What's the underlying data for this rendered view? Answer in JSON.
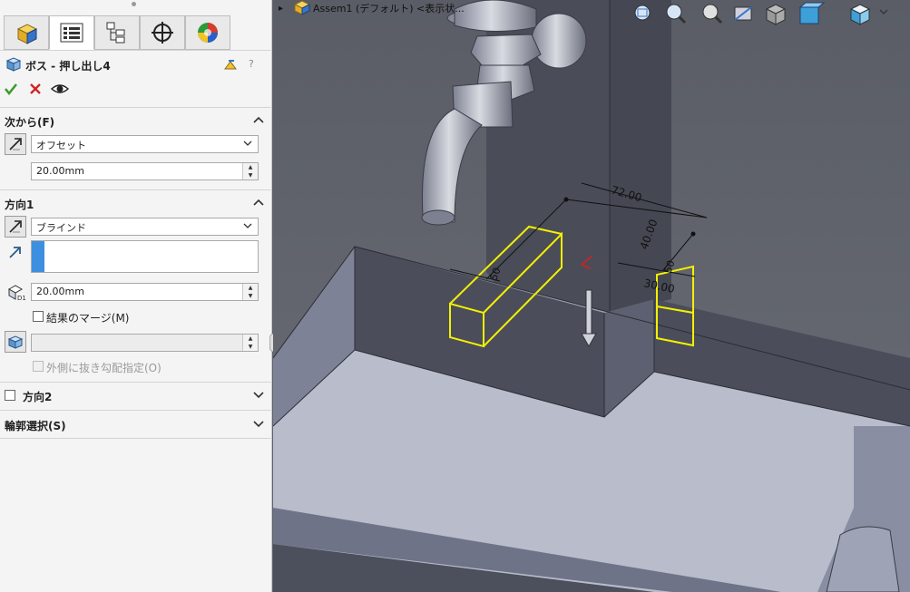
{
  "feature": {
    "title": "ボス - 押し出し4"
  },
  "tabs": [
    {
      "name": "featuremanager-tab"
    },
    {
      "name": "propertymanager-tab"
    },
    {
      "name": "configurationmanager-tab"
    },
    {
      "name": "dimxpert-tab"
    },
    {
      "name": "display-manager-tab"
    }
  ],
  "from_section": {
    "header": "次から(F)",
    "type_value": "オフセット",
    "offset_value": "20.00mm"
  },
  "direction1": {
    "header": "方向1",
    "end_condition": "ブラインド",
    "depth_value": "20.00mm",
    "merge_label": "結果のマージ(M)",
    "draft_outward_label": "外側に抜き勾配指定(O)"
  },
  "direction2": {
    "header": "方向2"
  },
  "contours": {
    "header": "輪郭選択(S)"
  },
  "viewport": {
    "breadcrumb": "Assem1 (デフォルト) <表示状...",
    "dim_72": "72.00",
    "dim_40": "40.00",
    "dim_30": "30.00",
    "dim_50a": "50",
    "dim_50b": "50"
  },
  "colors": {
    "accent_blue": "#3d8fe0",
    "sketch_yellow": "#f4f000",
    "ok_green": "#3a9a2a",
    "cancel_red": "#d42020",
    "background_gray": "#5e616a"
  }
}
